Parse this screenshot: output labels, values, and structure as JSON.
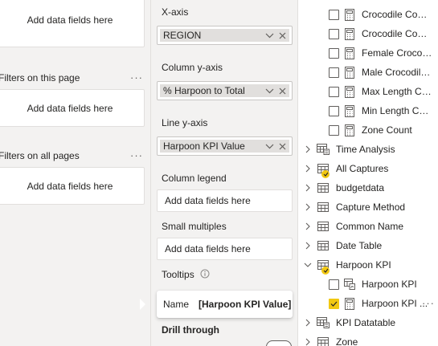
{
  "filters": {
    "top_well": "Add data fields here",
    "page_header": "Filters on this page",
    "page_well": "Add data fields here",
    "all_header": "Filters on all pages",
    "all_well": "Add data fields here",
    "more": "···"
  },
  "build": {
    "x_axis": {
      "label": "X-axis",
      "field": "REGION"
    },
    "column_y": {
      "label": "Column y-axis",
      "field": "% Harpoon to Total"
    },
    "line_y": {
      "label": "Line y-axis",
      "field": "Harpoon KPI Value"
    },
    "column_legend": {
      "label": "Column legend",
      "placeholder": "Add data fields here"
    },
    "small_multiples": {
      "label": "Small multiples",
      "placeholder": "Add data fields here"
    },
    "tooltips": {
      "label": "Tooltips"
    },
    "tooltip_card": {
      "name_key": "Name",
      "name_value": "[Harpoon KPI Value]"
    },
    "drill_through": {
      "label": "Drill through"
    }
  },
  "data_pane": {
    "fields": [
      {
        "label": "Crocodile Count ...",
        "checked": false,
        "icon": "calculator-icon"
      },
      {
        "label": "Crocodile Count ...",
        "checked": false,
        "icon": "calculator-icon"
      },
      {
        "label": "Female Crocodil...",
        "checked": false,
        "icon": "calculator-icon"
      },
      {
        "label": "Male Crocodile ...",
        "checked": false,
        "icon": "calculator-icon"
      },
      {
        "label": "Max Length Cap...",
        "checked": false,
        "icon": "calculator-icon"
      },
      {
        "label": "Min Length Capt...",
        "checked": false,
        "icon": "calculator-icon"
      },
      {
        "label": "Zone Count",
        "checked": false,
        "icon": "calculator-icon"
      }
    ],
    "tables": [
      {
        "label": "Time Analysis",
        "icon": "hierarchy-table-icon"
      },
      {
        "label": "All Captures",
        "icon": "table-icon",
        "badge": true
      },
      {
        "label": "budgetdata",
        "icon": "table-icon"
      },
      {
        "label": "Capture Method",
        "icon": "table-icon"
      },
      {
        "label": "Common Name",
        "icon": "table-icon"
      },
      {
        "label": "Date Table",
        "icon": "table-icon"
      }
    ],
    "harpoon_table": {
      "label": "Harpoon KPI",
      "icon": "table-icon",
      "badge": true,
      "expanded": true
    },
    "harpoon_fields": [
      {
        "label": "Harpoon KPI",
        "checked": false,
        "icon": "kpi-icon"
      },
      {
        "label": "Harpoon KPI ...",
        "checked": true,
        "icon": "calculator-icon"
      }
    ],
    "after_tables": [
      {
        "label": "KPI Datatable",
        "icon": "hierarchy-table-icon"
      },
      {
        "label": "Zone",
        "icon": "table-icon"
      }
    ],
    "more": "···"
  },
  "colors": {
    "accent_yellow": "#f2c811",
    "pane_bg": "#f3f2f1",
    "text": "#252423"
  }
}
